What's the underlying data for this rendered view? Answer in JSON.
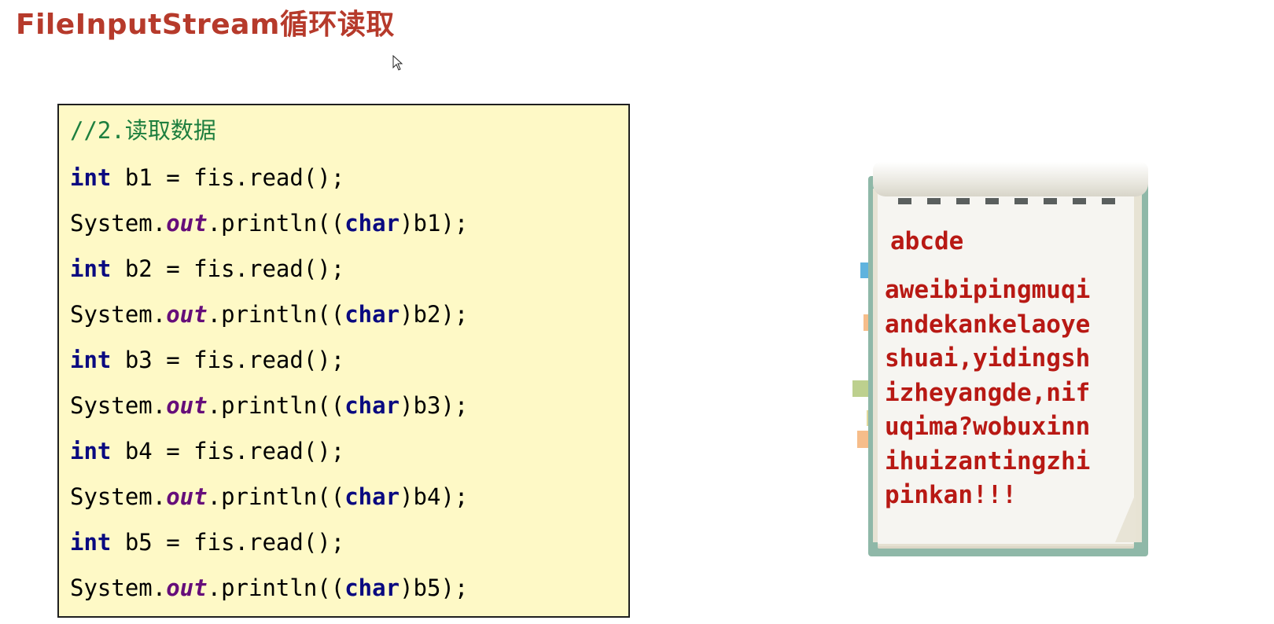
{
  "slide": {
    "title": "FileInputStream循环读取"
  },
  "code": {
    "comment": "//2.读取数据",
    "keyword_int": "int",
    "keyword_char": "char",
    "field_out": "out",
    "lines": [
      {
        "var": " b1 = fis.read();",
        "print_pre": "System.",
        "print_mid": ".println((",
        "print_post": ")b1);"
      },
      {
        "var": " b2 = fis.read();",
        "print_pre": "System.",
        "print_mid": ".println((",
        "print_post": ")b2);"
      },
      {
        "var": " b3 = fis.read();",
        "print_pre": "System.",
        "print_mid": ".println((",
        "print_post": ")b3);"
      },
      {
        "var": " b4 = fis.read();",
        "print_pre": "System.",
        "print_mid": ".println((",
        "print_post": ")b4);"
      },
      {
        "var": " b5 = fis.read();",
        "print_pre": "System.",
        "print_mid": ".println((",
        "print_post": ")b5);"
      }
    ]
  },
  "notebook": {
    "heading": "abcde",
    "body_lines": [
      "aweibipingmuqi",
      "andekankelaoye",
      "shuai,yidingsh",
      "izheyangde,nif",
      "uqima?wobuxinn",
      "ihuizantingzhi",
      "pinkan!!!"
    ],
    "text_color": "#b81914",
    "tab_colors": [
      "#5fb3de",
      "#f6bd8a",
      "#bdd08e",
      "#e1d89a",
      "#f6bd8a"
    ]
  },
  "colors": {
    "title": "#b63a2b",
    "code_background": "#fef9c6",
    "keyword": "#0a0a80",
    "field": "#660e7a",
    "comment": "#1e7f3f"
  },
  "icons": {
    "cursor": "mouse-pointer-icon"
  }
}
